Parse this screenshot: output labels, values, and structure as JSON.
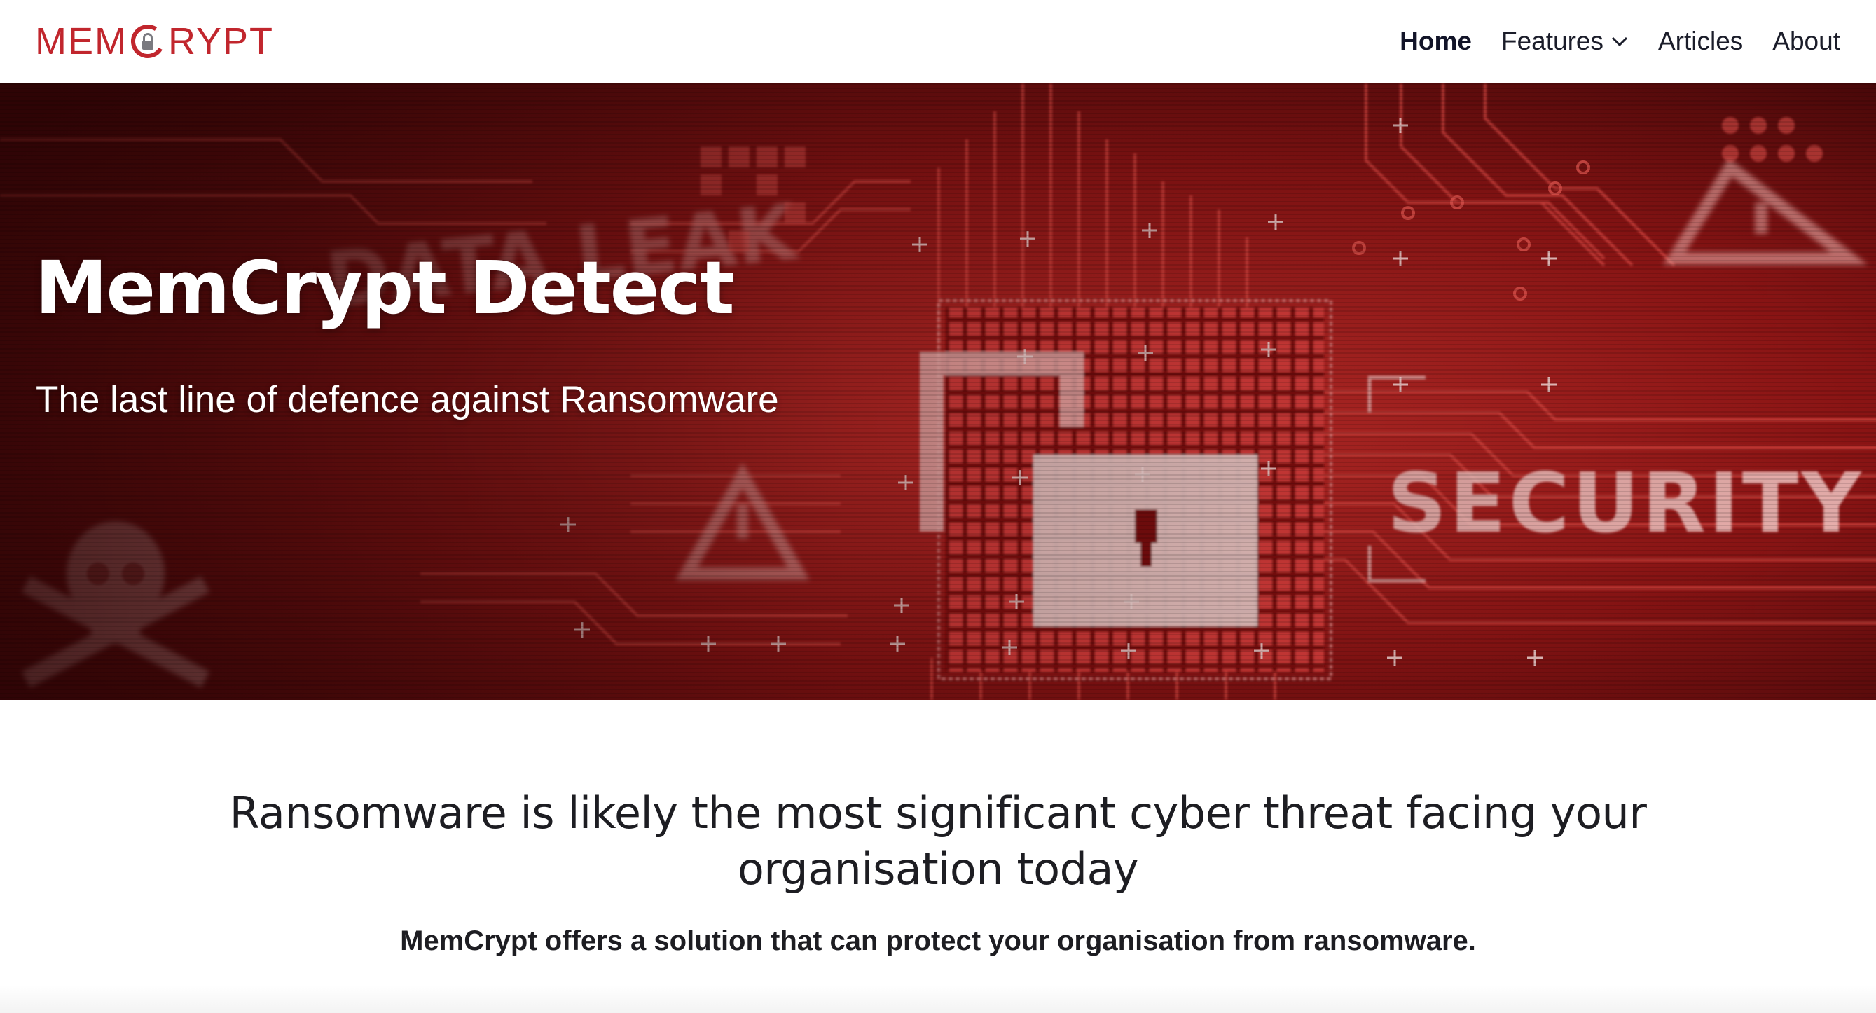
{
  "brand": {
    "logo_text_left": "MEM",
    "logo_text_right": "RYPT",
    "accent_color": "#c1262d"
  },
  "nav": {
    "items": [
      {
        "label": "Home",
        "active": true
      },
      {
        "label": "Features",
        "has_dropdown": true
      },
      {
        "label": "Articles"
      },
      {
        "label": "About"
      }
    ]
  },
  "hero": {
    "title": "MemCrypt Detect",
    "subtitle": "The last line of defence against Ransomware",
    "background_words": [
      "DATA LEAK",
      "SECURITY"
    ]
  },
  "intro": {
    "heading": "Ransomware is likely the most significant cyber threat facing your organisation today",
    "body": "MemCrypt offers a solution that can protect your organisation from ransomware."
  }
}
